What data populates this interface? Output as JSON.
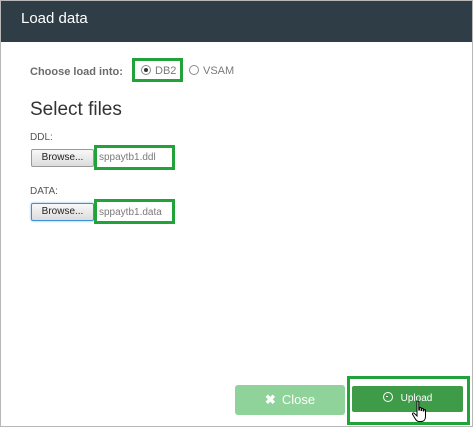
{
  "dialog": {
    "title": "Load data"
  },
  "load_into": {
    "label": "Choose load into:",
    "options": [
      {
        "label": "DB2",
        "selected": true
      },
      {
        "label": "VSAM",
        "selected": false
      }
    ]
  },
  "select_files": {
    "heading": "Select files",
    "ddl": {
      "label": "DDL:",
      "browse_label": "Browse...",
      "file_name": "sppaytb1.ddl"
    },
    "data": {
      "label": "DATA:",
      "browse_label": "Browse...",
      "file_name": "sppaytb1.data"
    }
  },
  "footer": {
    "close_label": "Close",
    "close_icon": "✖",
    "upload_label": "Upload"
  },
  "colors": {
    "header_bg": "#2f3d47",
    "highlight": "#21a33a",
    "close_bg": "#8fd39a",
    "upload_bg": "#3e9c48"
  }
}
